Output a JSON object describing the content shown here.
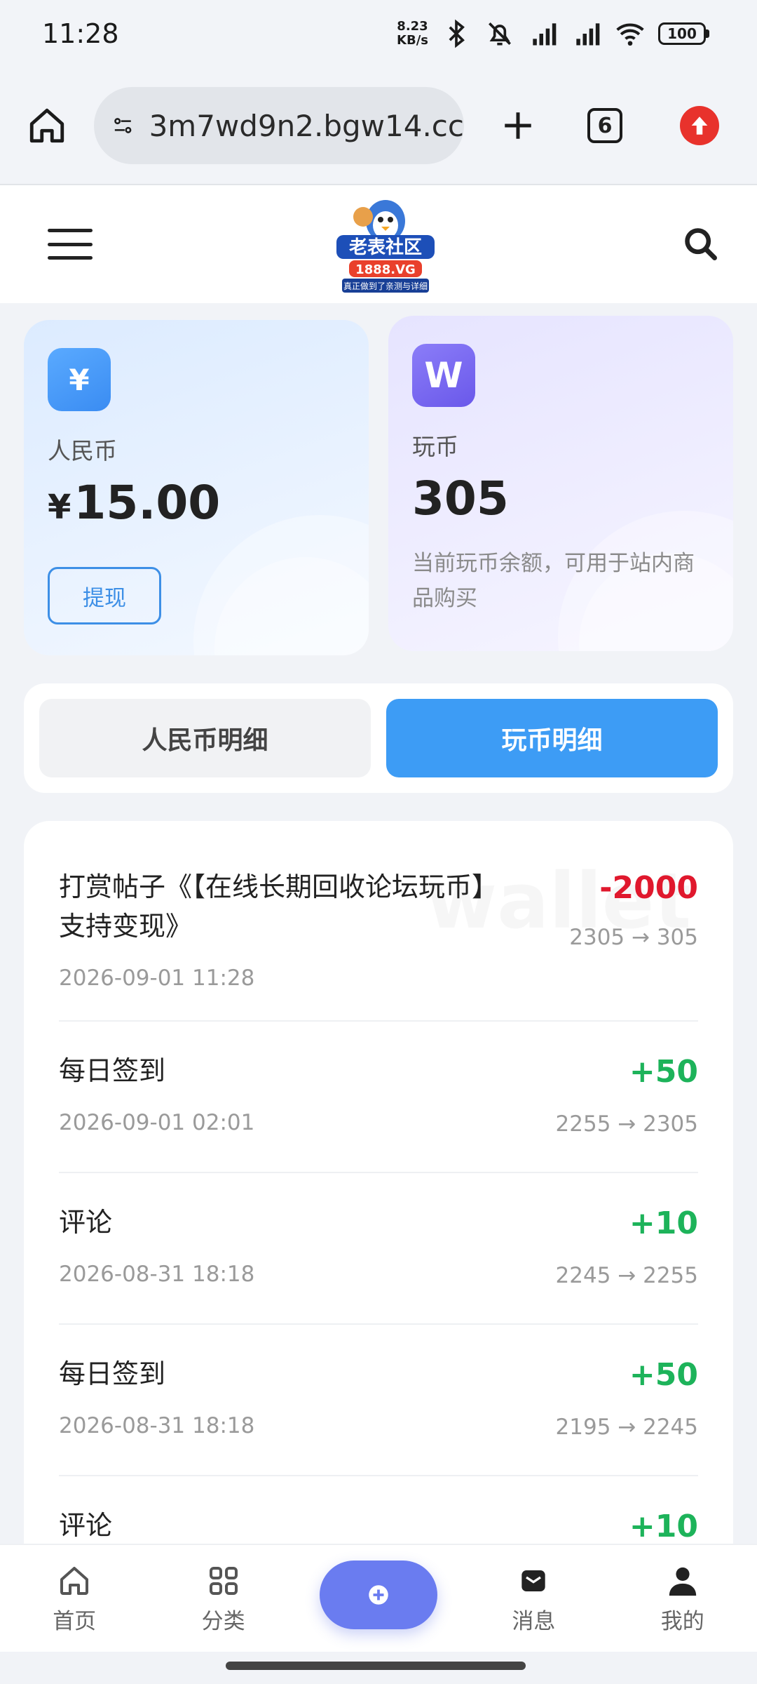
{
  "status_bar": {
    "time": "11:28",
    "net_speed_value": "8.23",
    "net_speed_unit": "KB/s",
    "battery": "100"
  },
  "browser": {
    "url": "3m7wd9n2.bgw14.cc",
    "tab_count": "6"
  },
  "site": {
    "logo_text": "老表社区",
    "logo_domain": "1888.VG",
    "logo_slogan": "真正做到了亲测与详细"
  },
  "wallet": {
    "rmb": {
      "icon_symbol": "¥",
      "label": "人民币",
      "currency": "¥",
      "amount": "15.00",
      "withdraw_label": "提现"
    },
    "coin": {
      "icon_symbol": "W",
      "label": "玩币",
      "amount": "305",
      "description": "当前玩币余额，可用于站内商品购买"
    }
  },
  "tabs": {
    "rmb_detail": "人民币明细",
    "coin_detail": "玩币明细"
  },
  "watermark": "wallet",
  "transactions": [
    {
      "title": "打赏帖子《【在线长期回收论坛玩币】支持变现》",
      "time": "2026-09-01 11:28",
      "amount": "-2000",
      "balance": "2305 → 305"
    },
    {
      "title": "每日签到",
      "time": "2026-09-01 02:01",
      "amount": "+50",
      "balance": "2255 → 2305"
    },
    {
      "title": "评论",
      "time": "2026-08-31 18:18",
      "amount": "+10",
      "balance": "2245 → 2255"
    },
    {
      "title": "每日签到",
      "time": "2026-08-31 18:18",
      "amount": "+50",
      "balance": "2195 → 2245"
    },
    {
      "title": "评论",
      "time": "",
      "amount": "+10",
      "balance": ""
    }
  ],
  "bottom_nav": {
    "home": "首页",
    "category": "分类",
    "messages": "消息",
    "mine": "我的"
  }
}
